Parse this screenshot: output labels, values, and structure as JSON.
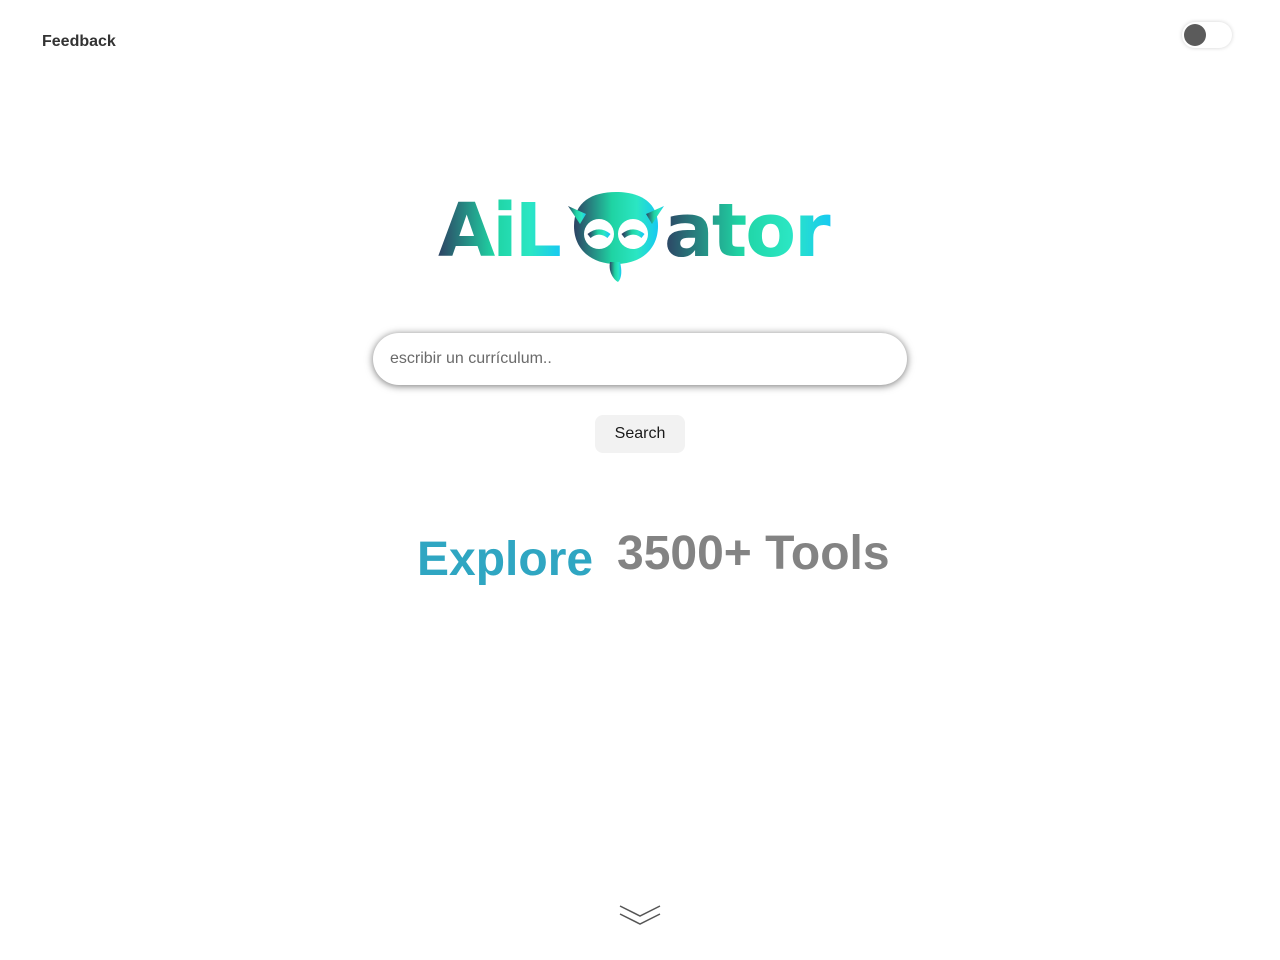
{
  "header": {
    "feedback_label": "Feedback"
  },
  "theme_toggle": {
    "state": "light"
  },
  "logo": {
    "text": "AiLocator",
    "left_part": "AiL",
    "right_part": "ator",
    "gradient_start": "#2d4263",
    "gradient_mid": "#1fd3a3",
    "gradient_end": "#17c9f2"
  },
  "search": {
    "placeholder": "escribir un currículum..",
    "value": "",
    "button_label": "Search"
  },
  "hero": {
    "explore": "Explore",
    "count": "3500+ Tools",
    "explore_color": "#2fa6c2",
    "count_color": "#838383"
  },
  "icons": {
    "scroll": "double-chevron-down-icon",
    "owl": "owl-icon"
  }
}
